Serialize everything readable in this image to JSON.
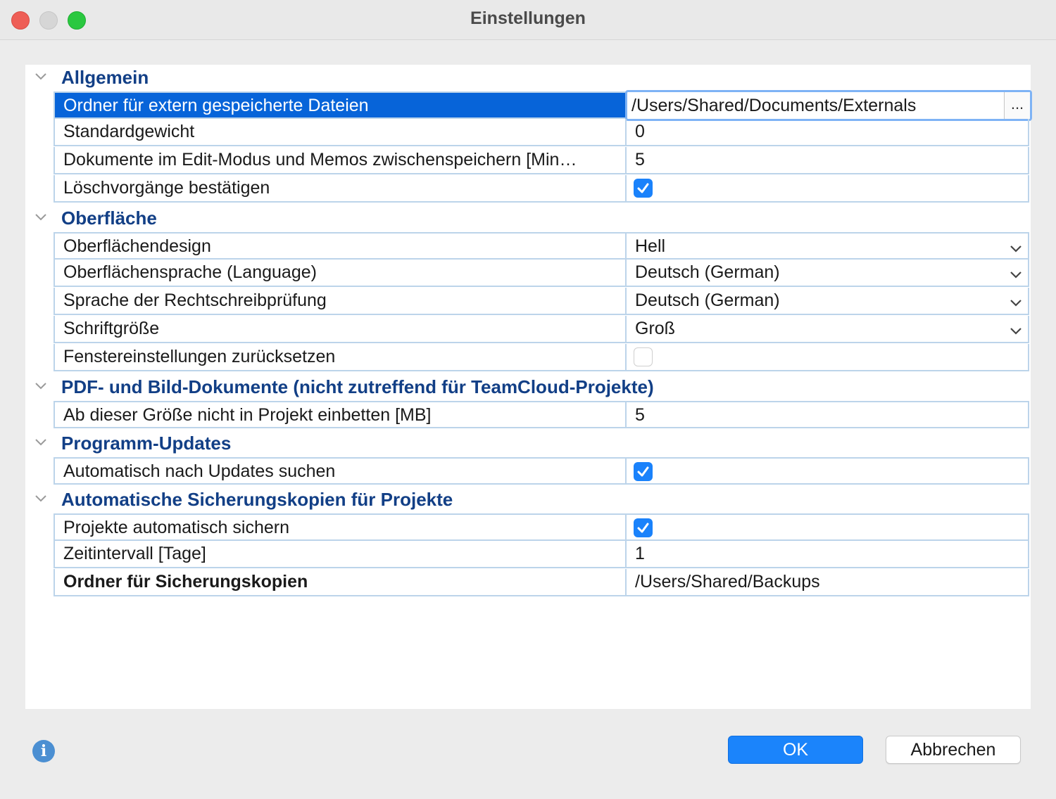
{
  "window": {
    "title": "Einstellungen"
  },
  "sections": [
    {
      "title": "Allgemein",
      "rows": [
        {
          "label": "Ordner für extern gespeicherte Dateien",
          "value": "/Users/Shared/Documents/Externals",
          "browse": "..."
        },
        {
          "label": "Standardgewicht",
          "value": "0"
        },
        {
          "label": "Dokumente im Edit-Modus und Memos zwischenspeichern [Min…",
          "value": "5"
        },
        {
          "label": "Löschvorgänge bestätigen",
          "checked": true
        }
      ]
    },
    {
      "title": "Oberfläche",
      "rows": [
        {
          "label": "Oberflächendesign",
          "value": "Hell"
        },
        {
          "label": "Oberflächensprache (Language)",
          "value": "Deutsch (German)"
        },
        {
          "label": "Sprache der Rechtschreibprüfung",
          "value": "Deutsch (German)"
        },
        {
          "label": "Schriftgröße",
          "value": "Groß"
        },
        {
          "label": "Fenstereinstellungen zurücksetzen",
          "checked": false
        }
      ]
    },
    {
      "title": "PDF- und Bild-Dokumente (nicht zutreffend für TeamCloud-Projekte)",
      "rows": [
        {
          "label": "Ab dieser Größe nicht in Projekt einbetten [MB]",
          "value": "5"
        }
      ]
    },
    {
      "title": "Programm-Updates",
      "rows": [
        {
          "label": "Automatisch nach Updates suchen",
          "checked": true
        }
      ]
    },
    {
      "title": "Automatische Sicherungskopien für Projekte",
      "rows": [
        {
          "label": "Projekte automatisch sichern",
          "checked": true
        },
        {
          "label": "Zeitintervall [Tage]",
          "value": "1"
        },
        {
          "label": "Ordner für Sicherungskopien",
          "value": "/Users/Shared/Backups"
        }
      ]
    }
  ],
  "footer": {
    "info_icon": "info-icon",
    "ok_label": "OK",
    "cancel_label": "Abbrechen"
  },
  "colors": {
    "accent": "#1b84fb",
    "selection": "#0764d9",
    "section_title": "#123f86",
    "grid": "#bcd4ea"
  }
}
